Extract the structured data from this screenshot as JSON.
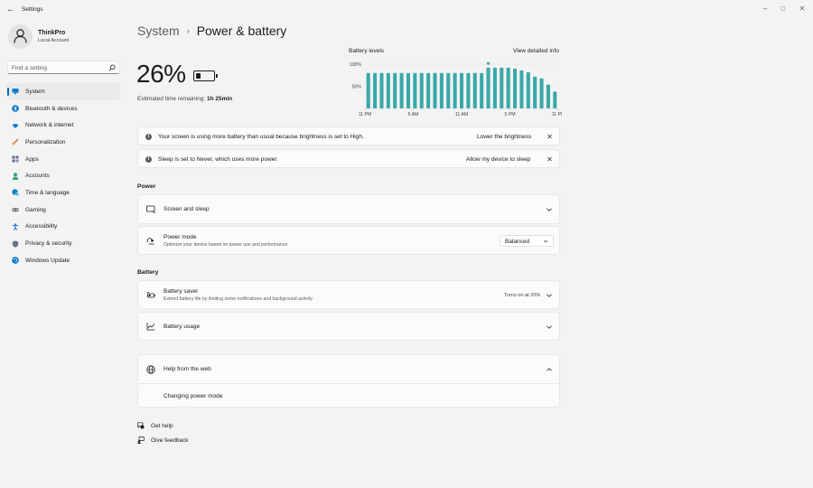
{
  "window": {
    "title": "Settings",
    "controls": {
      "minimize": "–",
      "maximize": "▢",
      "close": "✕"
    }
  },
  "user": {
    "name": "ThinkPro",
    "account": "Local Account"
  },
  "search": {
    "placeholder": "Find a setting"
  },
  "sidebar": {
    "items": [
      {
        "label": "System",
        "icon": "monitor-icon",
        "color": "#0078d4",
        "selected": true
      },
      {
        "label": "Bluetooth & devices",
        "icon": "bluetooth-icon",
        "color": "#0078d4"
      },
      {
        "label": "Network & internet",
        "icon": "wifi-icon",
        "color": "#0078d4"
      },
      {
        "label": "Personalization",
        "icon": "brush-icon",
        "color": "#c8683a"
      },
      {
        "label": "Apps",
        "icon": "apps-icon",
        "color": "#5d6b85"
      },
      {
        "label": "Accounts",
        "icon": "person-icon",
        "color": "#2fa36b"
      },
      {
        "label": "Time & language",
        "icon": "globe-clock-icon",
        "color": "#0a86c9"
      },
      {
        "label": "Gaming",
        "icon": "gamepad-icon",
        "color": "#7a7a7a"
      },
      {
        "label": "Accessibility",
        "icon": "accessibility-icon",
        "color": "#1a6fcc"
      },
      {
        "label": "Privacy & security",
        "icon": "shield-icon",
        "color": "#6b7380"
      },
      {
        "label": "Windows Update",
        "icon": "update-icon",
        "color": "#0078d4"
      }
    ]
  },
  "breadcrumb": {
    "root": "System",
    "separator": "›",
    "current": "Power & battery"
  },
  "battery": {
    "percent_text": "26%",
    "level": 0.26,
    "remaining_label": "Estimated time remaining:",
    "remaining_value": "1h 25min"
  },
  "chart_section": {
    "title": "Battery levels",
    "detail_link": "View detailed info"
  },
  "chart_data": {
    "type": "bar",
    "y_tick_labels": [
      "100%",
      "50%"
    ],
    "x_tick_labels": [
      "11 PM",
      "5 AM",
      "11 AM",
      "5 PM",
      "11 PM"
    ],
    "ylim": [
      0,
      100
    ],
    "values": [
      80,
      80,
      80,
      80,
      80,
      80,
      80,
      80,
      80,
      80,
      80,
      80,
      80,
      80,
      80,
      80,
      80,
      80,
      92,
      92,
      92,
      92,
      90,
      86,
      82,
      72,
      68,
      54,
      38
    ],
    "charging_index": 18,
    "bar_color": "#3aa8a8",
    "grid": true
  },
  "notices": [
    {
      "text": "Your screen is using more battery than usual because brightness is set to High.",
      "action": "Lower the brightness"
    },
    {
      "text": "Sleep is set to Never, which uses more power.",
      "action": "Allow my device to sleep"
    }
  ],
  "power_section": {
    "title": "Power",
    "screen_sleep": {
      "title": "Screen and sleep"
    },
    "power_mode": {
      "title": "Power mode",
      "subtitle": "Optimize your device based on power use and performance",
      "selected": "Balanced"
    }
  },
  "battery_section": {
    "title": "Battery",
    "saver": {
      "title": "Battery saver",
      "subtitle": "Extend battery life by limiting some notifications and background activity",
      "value": "Turns on at 20%"
    },
    "usage": {
      "title": "Battery usage"
    }
  },
  "help": {
    "title": "Help from the web",
    "links": [
      "Changing power mode"
    ]
  },
  "footer": {
    "get_help": "Get help",
    "give_feedback": "Give feedback"
  }
}
